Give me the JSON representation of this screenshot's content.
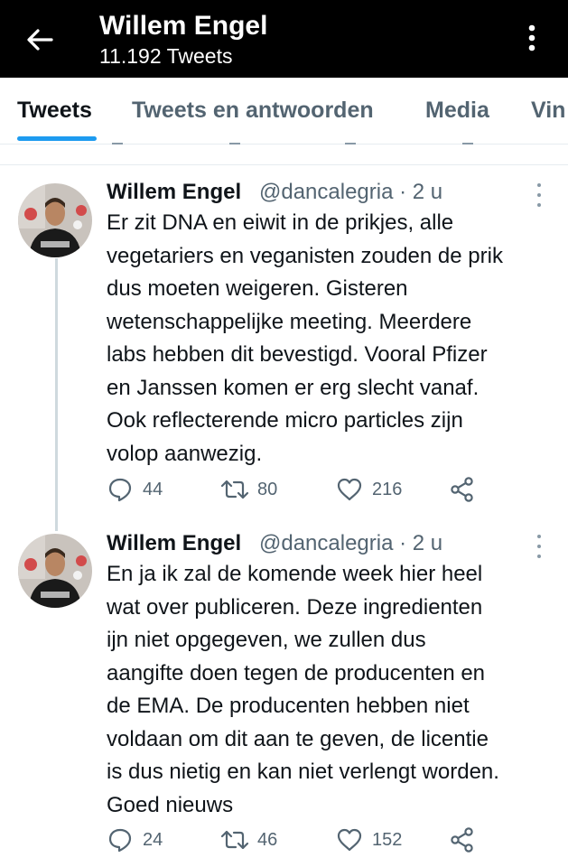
{
  "header": {
    "title": "Willem Engel",
    "subtitle": "11.192 Tweets"
  },
  "tabs": [
    {
      "label": "Tweets"
    },
    {
      "label": "Tweets en antwoorden"
    },
    {
      "label": "Media"
    },
    {
      "label": "Vin"
    }
  ],
  "tweets": [
    {
      "name": "Willem Engel",
      "handle": "@dancalegria",
      "time": "2 u",
      "lines": [
        "Er zit DNA en eiwit in de prikjes, alle",
        "vegetariers en veganisten zouden de prik",
        "dus moeten weigeren. Gisteren",
        "wetenschappelijke meeting. Meerdere",
        "labs hebben dit bevestigd. Vooral Pfizer",
        "en Janssen komen er erg slecht vanaf.",
        "Ook reflecterende micro particles zijn",
        "volop aanwezig."
      ],
      "replies": "44",
      "retweets": "80",
      "likes": "216"
    },
    {
      "name": "Willem Engel",
      "handle": "@dancalegria",
      "time": "2 u",
      "lines": [
        "En ja ik zal de komende week hier heel",
        "wat over publiceren. Deze ingredienten",
        "ijn niet opgegeven, we zullen dus",
        "aangifte doen tegen de producenten en",
        "de EMA. De producenten hebben niet",
        "voldaan om dit aan te geven, de licentie",
        "is dus nietig en kan niet verlengt worden.",
        "Goed nieuws"
      ],
      "replies": "24",
      "retweets": "46",
      "likes": "152"
    }
  ],
  "colors": {
    "accent": "#1d9bf0",
    "header_bg": "#000000",
    "muted": "#536471"
  },
  "icons": [
    "back-arrow-icon",
    "more-vertical-icon",
    "reply-icon",
    "retweet-icon",
    "like-icon",
    "share-icon"
  ]
}
